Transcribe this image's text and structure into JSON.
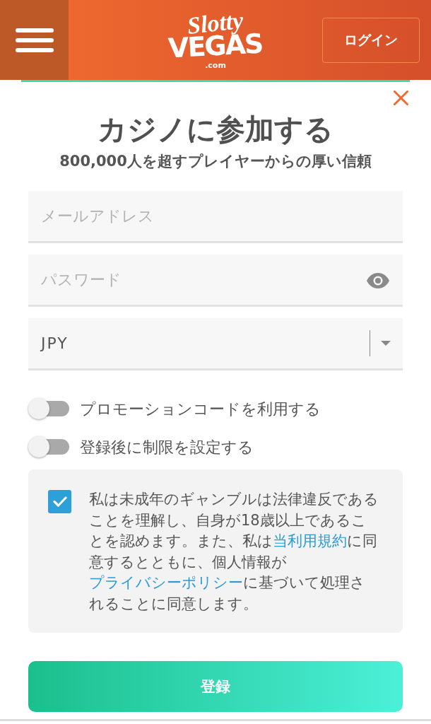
{
  "header": {
    "logo": {
      "script": "Slotty",
      "main": "VEGAS",
      "suffix": ".com"
    },
    "login_button": "ログイン"
  },
  "title": "カジノに参加する",
  "subtitle": "800,000人を超すプレイヤーからの厚い信頼",
  "fields": [
    {
      "kind": "email",
      "placeholder": "メールアドレス"
    },
    {
      "kind": "password",
      "placeholder": "パスワード"
    },
    {
      "kind": "select",
      "value": "JPY"
    }
  ],
  "toggles": [
    {
      "label": "プロモーションコードを利用する",
      "on": false
    },
    {
      "label": "登録後に制限を設定する",
      "on": false
    }
  ],
  "consent": {
    "checked": true,
    "parts": [
      {
        "kind": "text",
        "text": "私は未成年のギャンブルは法律違反であることを理解し、自身が18歳以上であることを認めます。また、私は"
      },
      {
        "kind": "link",
        "text": "当利用規約"
      },
      {
        "kind": "text",
        "text": "に同意するとともに、個人情報が"
      },
      {
        "kind": "link",
        "text": "プライバシーポリシー"
      },
      {
        "kind": "text",
        "text": "に基づいて処理されることに同意します。"
      }
    ]
  },
  "submit_button": "登録"
}
